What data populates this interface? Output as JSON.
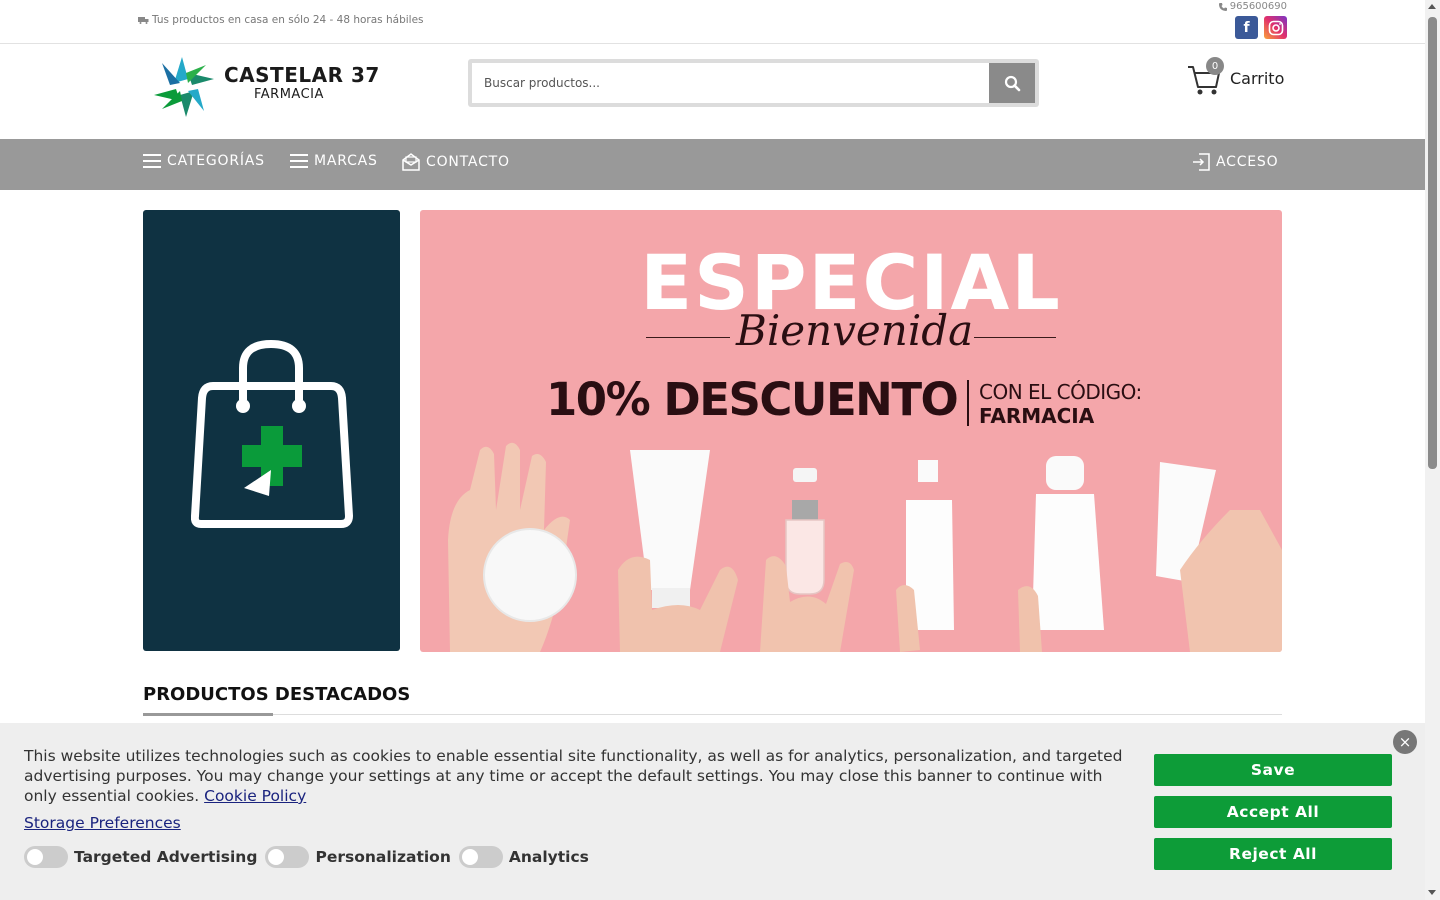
{
  "topbar": {
    "shipping_text": "Tus productos en casa en sólo 24 - 48 horas hábiles",
    "phone": "965600690",
    "facebook_label": "f"
  },
  "header": {
    "logo_name": "CASTELAR 37",
    "logo_sub": "FARMACIA",
    "search_placeholder": "Buscar productos...",
    "cart_count": "0",
    "cart_label": "Carrito"
  },
  "nav": {
    "categorias": "CATEGORÍAS",
    "marcas": "MARCAS",
    "contacto": "CONTACTO",
    "acceso": "ACCESO"
  },
  "banner": {
    "title": "ESPECIAL",
    "script": "Bienvenida",
    "discount": "10% DESCUENTO",
    "code_prefix": "CON EL CÓDIGO:",
    "code": "FARMACIA"
  },
  "products": {
    "heading": "PRODUCTOS DESTACADOS"
  },
  "cookie": {
    "text": "This website utilizes technologies such as cookies to enable essential site functionality, as well as for analytics, personalization, and targeted advertising purposes. You may change your settings at any time or accept the default settings. You may close this banner to continue with only essential cookies.",
    "policy_link": "Cookie Policy",
    "storage_link": "Storage Preferences",
    "toggles": [
      "Targeted Advertising",
      "Personalization",
      "Analytics"
    ],
    "save": "Save",
    "accept_all": "Accept All",
    "reject_all": "Reject All"
  },
  "colors": {
    "nav_bg": "#999999",
    "banner_bg": "#f4a6aa",
    "left_banner_bg": "#0f3242",
    "cookie_button": "#0d9c38",
    "pharmacy_green": "#0a9b3a"
  }
}
